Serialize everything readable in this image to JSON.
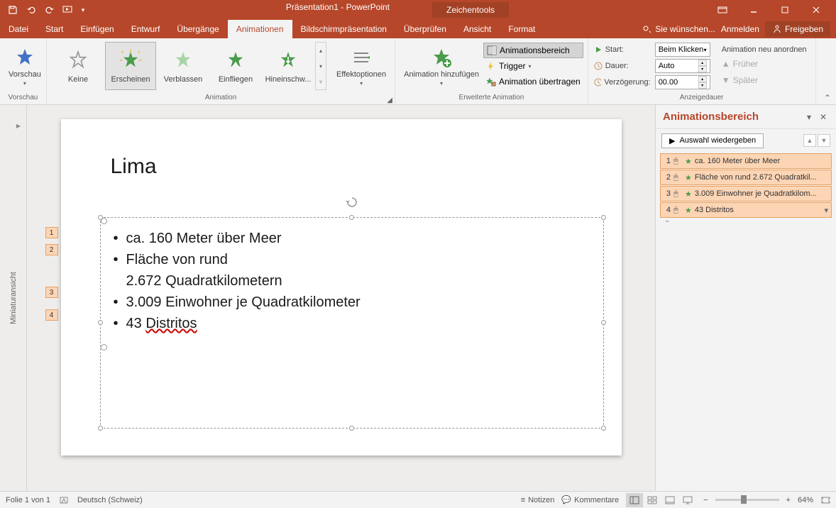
{
  "title": "Präsentation1 - PowerPoint",
  "drawing_tools": "Zeichentools",
  "tabs": [
    "Datei",
    "Start",
    "Einfügen",
    "Entwurf",
    "Übergänge",
    "Animationen",
    "Bildschirmpräsentation",
    "Überprüfen",
    "Ansicht",
    "Format"
  ],
  "active_tab": "Animationen",
  "tell_me": "Sie wünschen...",
  "signin": "Anmelden",
  "share": "Freigeben",
  "ribbon": {
    "preview": {
      "label": "Vorschau",
      "group": "Vorschau"
    },
    "animation_group": "Animation",
    "animations": [
      {
        "name": "Keine",
        "color": "#999"
      },
      {
        "name": "Erscheinen",
        "color": "#4a9b4a",
        "selected": true
      },
      {
        "name": "Verblassen",
        "color": "#4a9b4a"
      },
      {
        "name": "Einfliegen",
        "color": "#4a9b4a"
      },
      {
        "name": "Hineinschw...",
        "color": "#4a9b4a"
      }
    ],
    "effect_options": "Effektoptionen",
    "advanced_group": "Erweiterte Animation",
    "add_animation": "Animation hinzufügen",
    "animation_pane": "Animationsbereich",
    "trigger": "Trigger",
    "painter": "Animation übertragen",
    "timing_group": "Anzeigedauer",
    "start_label": "Start:",
    "start_value": "Beim Klicken",
    "duration_label": "Dauer:",
    "duration_value": "Auto",
    "delay_label": "Verzögerung:",
    "delay_value": "00.00",
    "reorder_label": "Animation neu anordnen",
    "earlier": "Früher",
    "later": "Später"
  },
  "thumbnail_label": "Miniaturansicht",
  "slide": {
    "title": "Lima",
    "bullets": [
      "ca. 160 Meter über Meer",
      "Fläche von rund 2.672 Quadratkilometern",
      "3.009 Einwohner je Quadratkilometer",
      "43 Distritos"
    ],
    "tags": [
      1,
      2,
      3,
      4
    ]
  },
  "pane": {
    "title": "Animationsbereich",
    "play": "Auswahl wiedergeben",
    "items": [
      {
        "n": 1,
        "text": "ca. 160 Meter über Meer"
      },
      {
        "n": 2,
        "text": "Fläche von rund 2.672 Quadratkil..."
      },
      {
        "n": 3,
        "text": "3.009 Einwohner je Quadratkilom..."
      },
      {
        "n": 4,
        "text": "43 Distritos"
      }
    ]
  },
  "status": {
    "slide": "Folie 1 von 1",
    "lang": "Deutsch (Schweiz)",
    "notes": "Notizen",
    "comments": "Kommentare",
    "zoom": "64%"
  }
}
